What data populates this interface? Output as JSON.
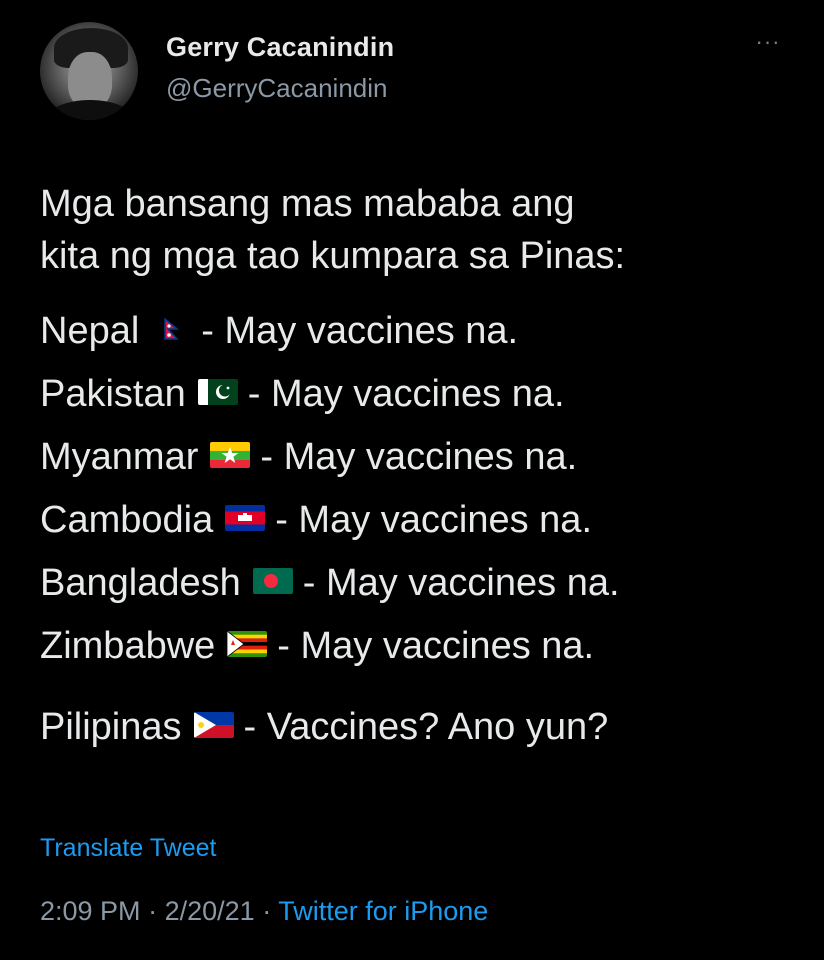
{
  "user": {
    "display_name": "Gerry Cacanindin",
    "handle": "@GerryCacanindin",
    "more_label": "···"
  },
  "tweet": {
    "intro_lines": [
      "Mga bansang mas mababa ang",
      "kita ng mga tao kumpara sa Pinas:"
    ],
    "countries": [
      {
        "name": "Nepal",
        "flag_icon": "nepal-flag-icon",
        "status": "- May vaccines na."
      },
      {
        "name": "Pakistan",
        "flag_icon": "pakistan-flag-icon",
        "status": "- May vaccines na."
      },
      {
        "name": "Myanmar",
        "flag_icon": "myanmar-flag-icon",
        "status": "- May vaccines na."
      },
      {
        "name": "Cambodia",
        "flag_icon": "cambodia-flag-icon",
        "status": "- May vaccines na."
      },
      {
        "name": "Bangladesh",
        "flag_icon": "bangladesh-flag-icon",
        "status": "- May vaccines na."
      },
      {
        "name": "Zimbabwe",
        "flag_icon": "zimbabwe-flag-icon",
        "status": "- May vaccines na."
      }
    ],
    "closing": {
      "name": "Pilipinas",
      "flag_icon": "philippines-flag-icon",
      "status": "- Vaccines? Ano yun?"
    }
  },
  "translate_label": "Translate Tweet",
  "meta": {
    "time": "2:09 PM",
    "separator": "·",
    "date": "2/20/21",
    "source": "Twitter for iPhone"
  },
  "colors": {
    "background": "#000000",
    "text": "#e7e9ea",
    "secondary": "#8b98a5",
    "link": "#1d9bf0"
  }
}
